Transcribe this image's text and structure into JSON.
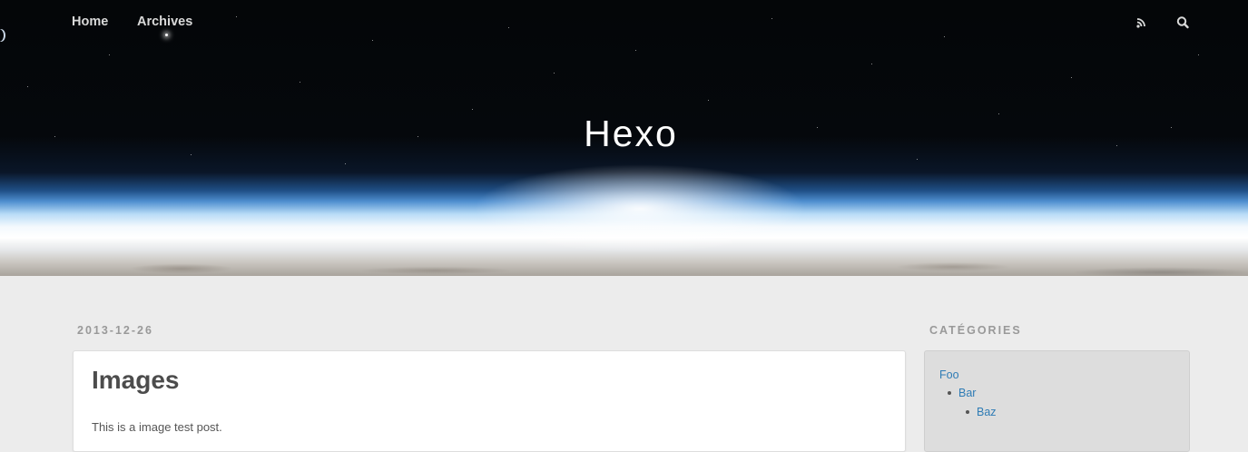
{
  "nav": {
    "home_label": "Home",
    "archives_label": "Archives",
    "rss_icon": "rss-icon",
    "search_icon": "search-icon"
  },
  "site": {
    "title": "Hexo"
  },
  "article": {
    "date": "2013-12-26",
    "title": "Images",
    "excerpt": "This is a image test post."
  },
  "sidebar": {
    "widget_title": "CATÉGORIES",
    "categories": [
      {
        "label": "Foo",
        "children": [
          {
            "label": "Bar",
            "children": [
              {
                "label": "Baz"
              }
            ]
          }
        ]
      }
    ]
  },
  "colors": {
    "link": "#2f7cb5",
    "background": "#ececec",
    "muted": "#999999"
  }
}
